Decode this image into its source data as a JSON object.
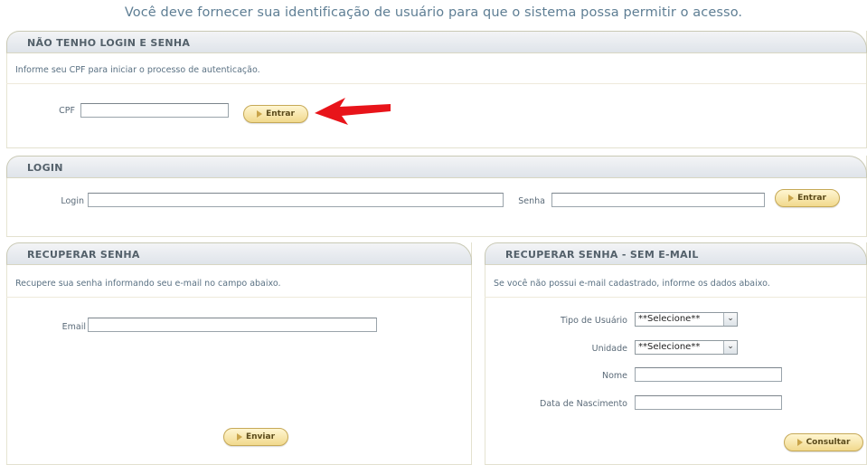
{
  "intro": "Você deve fornecer sua identificação de usuário para que o sistema possa permitir o acesso.",
  "no_login": {
    "title": "NÃO TENHO LOGIN E SENHA",
    "info": "Informe seu CPF para iniciar o processo de autenticação.",
    "cpf_label": "CPF",
    "cpf_value": "",
    "button": "Entrar"
  },
  "login": {
    "title": "LOGIN",
    "login_label": "Login",
    "login_value": "",
    "senha_label": "Senha",
    "senha_value": "",
    "button": "Entrar"
  },
  "recover": {
    "title": "RECUPERAR SENHA",
    "info": "Recupere sua senha informando seu e-mail no campo abaixo.",
    "email_label": "Email",
    "email_value": "",
    "button": "Enviar"
  },
  "recover_no_email": {
    "title": "RECUPERAR SENHA - SEM E-MAIL",
    "info": "Se você não possui e-mail cadastrado, informe os dados abaixo.",
    "tipo_label": "Tipo de Usuário",
    "tipo_value": "**Selecione**",
    "unidade_label": "Unidade",
    "unidade_value": "**Selecione**",
    "nome_label": "Nome",
    "nome_value": "",
    "nascimento_label": "Data de Nascimento",
    "nascimento_value": "",
    "button": "Consultar"
  },
  "icons": {
    "button_bullet": "play-triangle-icon",
    "annotation": "red-arrow-icon",
    "dropdown": "chevron-down-icon"
  },
  "colors": {
    "header_text": "#5e7e94",
    "button_fill": "#f1d98d",
    "annotation": "#e8141a"
  }
}
